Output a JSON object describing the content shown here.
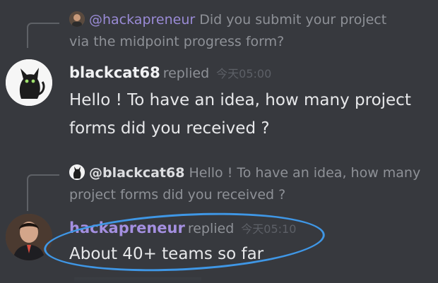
{
  "messages": [
    {
      "reply": {
        "mention": "@hackapreneur",
        "text": "Did you submit your project via the midpoint progress form?"
      },
      "author": "blackcat68",
      "verb": "replied",
      "time": "今天05:00",
      "content": "Hello ! To have an idea, how many project forms did you received ?",
      "avatar_icon": "black-cat-avatar"
    },
    {
      "reply": {
        "mention": "@blackcat68",
        "text": "Hello ! To have an idea, how many project forms did you received ?"
      },
      "author": "hackapreneur",
      "verb": "replied",
      "time": "今天05:10",
      "content": "About 40+ teams so far",
      "avatar_icon": "person-avatar"
    }
  ],
  "colors": {
    "background": "#37393e",
    "highlight": "#3f97e6",
    "mention": "#9a8bd6",
    "hackapreneur_name": "#a48fe0"
  }
}
